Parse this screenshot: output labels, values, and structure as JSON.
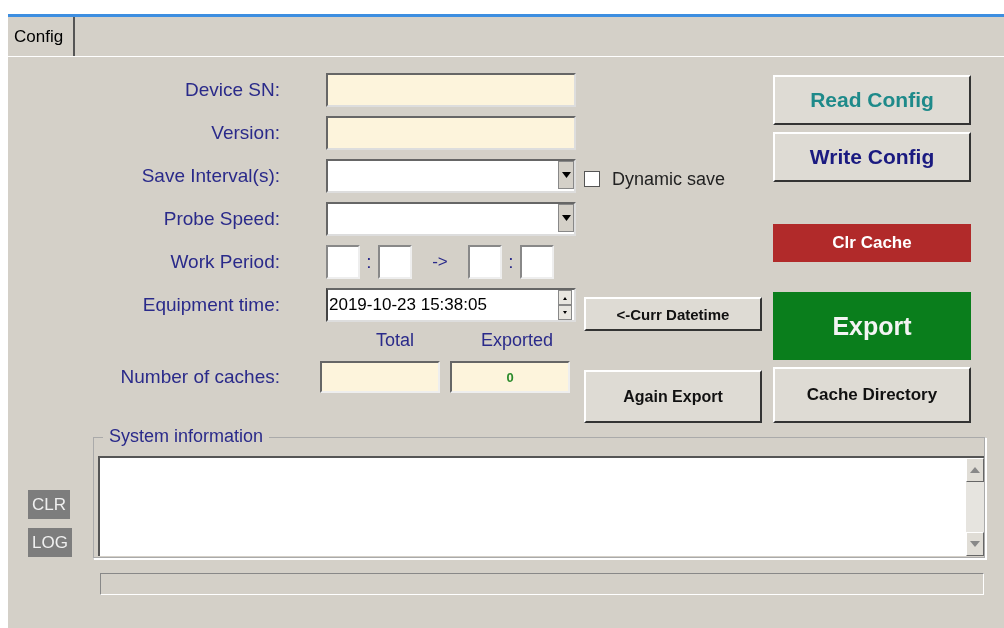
{
  "tabs": [
    {
      "label": "Config",
      "selected": true
    }
  ],
  "fields": [
    {
      "kind": "text",
      "label": "Device SN:",
      "readonly": true
    },
    {
      "kind": "text",
      "label": "Version:",
      "readonly": true
    },
    {
      "kind": "combo",
      "label": "Save Interval(s):"
    },
    {
      "kind": "combo",
      "label": "Probe Speed:"
    },
    {
      "kind": "period",
      "label": "Work Period:",
      "separator": ":",
      "arrow": "->"
    },
    {
      "kind": "datetime",
      "label": "Equipment time:",
      "value": "2019-10-23 15:38:05"
    }
  ],
  "dynamic_save": {
    "label": "Dynamic save",
    "checked": false
  },
  "curr_datetime_button": "<-Curr Datetime",
  "caches": {
    "label": "Number of caches:",
    "total_header": "Total",
    "exported_header": "Exported",
    "exported": "0"
  },
  "again_export_button": "Again Export",
  "right_buttons": [
    {
      "label": "Read Config",
      "kind": "teal"
    },
    {
      "label": "Write Config",
      "kind": "navy"
    },
    {
      "label": "Clr Cache",
      "kind": "danger"
    },
    {
      "label": "Export",
      "kind": "success"
    },
    {
      "label": "Cache Directory",
      "kind": "plain"
    }
  ],
  "system_info": {
    "title": "System information"
  },
  "log_buttons": [
    "CLR",
    "LOG"
  ],
  "progress": {
    "level": 0
  }
}
